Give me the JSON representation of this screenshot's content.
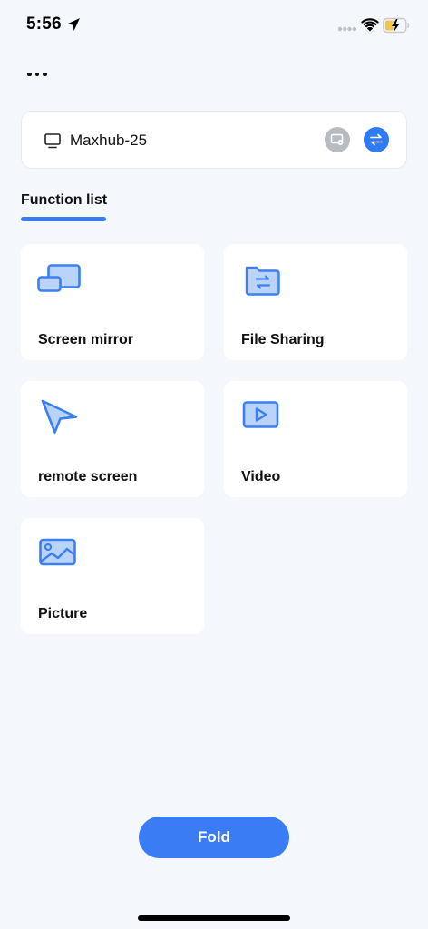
{
  "status_bar": {
    "time": "5:56"
  },
  "device": {
    "name": "Maxhub-25"
  },
  "function_list": {
    "title": "Function list",
    "items": [
      {
        "label": "Screen mirror",
        "icon": "screen-mirror-icon"
      },
      {
        "label": "File Sharing",
        "icon": "file-sharing-icon"
      },
      {
        "label": "remote screen",
        "icon": "remote-screen-icon"
      },
      {
        "label": "Video",
        "icon": "video-icon"
      },
      {
        "label": "Picture",
        "icon": "picture-icon"
      }
    ]
  },
  "fold_button": {
    "label": "Fold"
  },
  "colors": {
    "accent": "#3a7cf4",
    "background": "#f4f7fc",
    "icon_fill": "#b9d3fb",
    "icon_stroke": "#3b80f2",
    "disabled_gray": "#b8bcc2"
  }
}
